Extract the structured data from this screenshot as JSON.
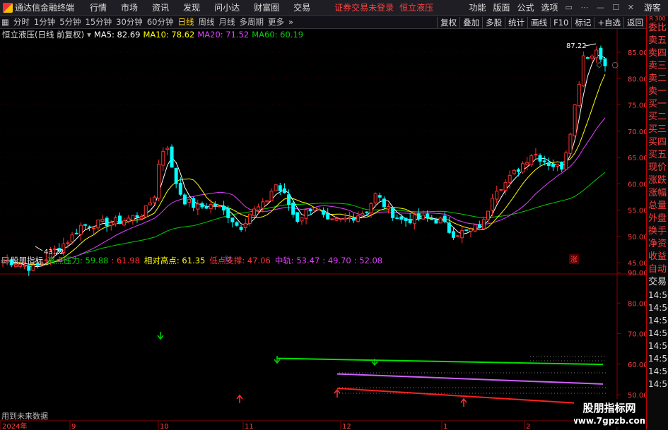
{
  "app": {
    "title": "通达信金融终端"
  },
  "menu": [
    "行情",
    "市场",
    "资讯",
    "发现",
    "问小达",
    "财富圈",
    "交易"
  ],
  "login_warning": "证券交易未登录",
  "stock_name": "恒立液压",
  "right_menu": [
    "功能",
    "版面",
    "公式",
    "选项"
  ],
  "guest_label": "游客",
  "toolbar": {
    "periods": [
      "分时",
      "1分钟",
      "5分钟",
      "15分钟",
      "30分钟",
      "60分钟",
      "日线",
      "周线",
      "月线",
      "多周期",
      "更多"
    ],
    "active_period": "日线",
    "buttons": [
      "复权",
      "叠加",
      "多股",
      "统计",
      "画线",
      "F10",
      "标记",
      "+自选",
      "返回"
    ]
  },
  "sidebar": {
    "badge": "R 300",
    "items": [
      "委比",
      "卖五",
      "卖四",
      "卖三",
      "卖二",
      "卖一",
      "买一",
      "买二",
      "买三",
      "买四",
      "买五",
      "现价",
      "涨跌",
      "涨幅",
      "总量",
      "外盘",
      "换手",
      "净资",
      "收益",
      "自动",
      "交易",
      "14:56",
      "14:56",
      "14:56",
      "14:56",
      "14:56",
      "14:56",
      "14:56",
      "14:56"
    ]
  },
  "main_legend": {
    "title": "恒立液压(日线 前复权)",
    "ma5": "MA5: 82.69",
    "ma10": "MA10: 78.62",
    "ma20": "MA20: 71.52",
    "ma60": "MA60: 60.19"
  },
  "colors": {
    "ma5": "#ffffff",
    "ma10": "#ffff00",
    "ma20": "#e040ff",
    "ma60": "#00d000",
    "up": "#ff3030",
    "down": "#00ffff"
  },
  "main_axis": [
    "85.00",
    "80.00",
    "75.00",
    "70.00",
    "65.00",
    "60.00",
    "55.00",
    "50.00",
    "45.00"
  ],
  "annotations": {
    "high": "87.22",
    "low": "43.22",
    "mark_cai": "财",
    "mark_zhang": "涨"
  },
  "sub_legend": {
    "name": "股朋指标",
    "high_pressure": "高点压力: 59.88",
    "high_pressure_2": ": 61.98",
    "relative_high": "相对高点: 61.35",
    "low_support": "低点支撑: 47.06",
    "middle": "中轨: 53.47",
    "middle_2": ": 49.70",
    "middle_3": ": 52.08"
  },
  "sub_axis": [
    "90.00",
    "80.00",
    "70.00",
    "60.00",
    "50.00"
  ],
  "sub_note": "用到未来数据",
  "time_axis": [
    "2024年",
    "9",
    "10",
    "11",
    "12",
    "1",
    "2"
  ],
  "watermark": {
    "line1": "股朋指标网",
    "line2": "www.7gpzb.com"
  }
}
